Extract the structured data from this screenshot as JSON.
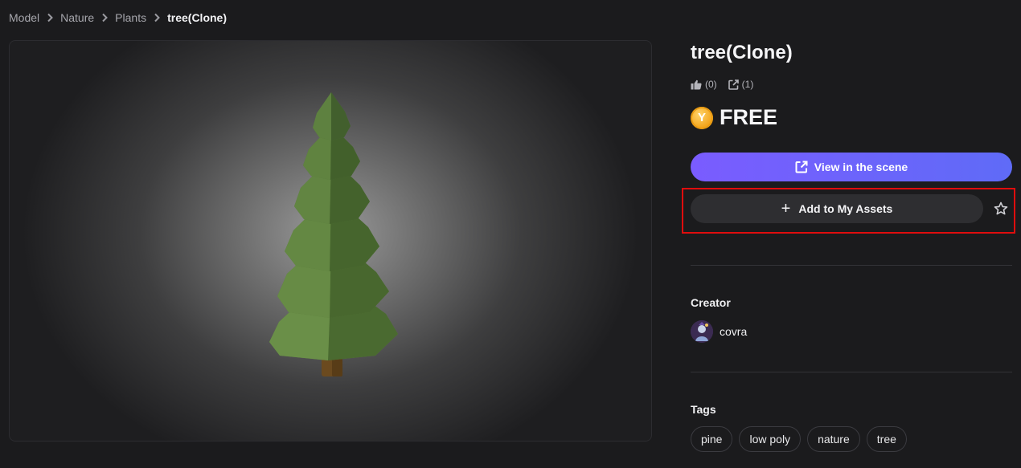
{
  "breadcrumb": {
    "items": [
      "Model",
      "Nature",
      "Plants"
    ],
    "current": "tree(Clone)"
  },
  "asset": {
    "title": "tree(Clone)",
    "likes": "(0)",
    "shares": "(1)",
    "price": "FREE",
    "coin_symbol": "Y"
  },
  "actions": {
    "view_scene_label": "View in the scene",
    "add_assets_label": "Add to My Assets",
    "add_icon": "+"
  },
  "creator": {
    "label": "Creator",
    "name": "covra"
  },
  "tags": {
    "label": "Tags",
    "items": [
      "pine",
      "low poly",
      "nature",
      "tree"
    ]
  },
  "colors": {
    "accent_gradient_start": "#7a5cff",
    "accent_gradient_end": "#5f6bf7",
    "highlight": "#e00d0d",
    "foliage": "#5a7d3c",
    "trunk": "#6b4a1f"
  }
}
